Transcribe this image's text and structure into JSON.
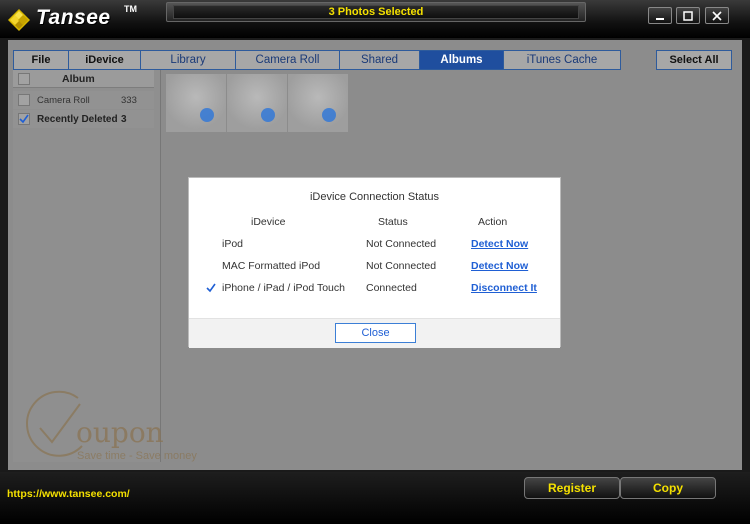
{
  "app": {
    "logo_text": "Tansee",
    "logo_tm": "TM",
    "title": "3 Photos Selected"
  },
  "tabs": [
    {
      "label": "File"
    },
    {
      "label": "iDevice"
    },
    {
      "label": "Library"
    },
    {
      "label": "Camera Roll"
    },
    {
      "label": "Shared"
    },
    {
      "label": "Albums"
    },
    {
      "label": "iTunes Cache"
    }
  ],
  "active_tab": "Albums",
  "select_all_label": "Select All",
  "album_list": {
    "header": "Album",
    "items": [
      {
        "name": "Camera Roll",
        "count": "333",
        "checked": false
      },
      {
        "name": "Recently Deleted",
        "count": "3",
        "checked": true
      }
    ]
  },
  "dialog": {
    "title": "iDevice Connection Status",
    "headers": {
      "device": "iDevice",
      "status": "Status",
      "action": "Action"
    },
    "rows": [
      {
        "device": "iPod",
        "status": "Not Connected",
        "action": "Detect Now",
        "selected": false
      },
      {
        "device": "MAC Formatted iPod",
        "status": "Not Connected",
        "action": "Detect Now",
        "selected": false
      },
      {
        "device": "iPhone / iPad / iPod Touch",
        "status": "Connected",
        "action": "Disconnect It",
        "selected": true
      }
    ],
    "close_label": "Close"
  },
  "watermark": {
    "text": "oupon",
    "sub": "Save time - Save money"
  },
  "footer": {
    "url": "https://www.tansee.com/",
    "register_label": "Register",
    "copy_label": "Copy"
  },
  "colors": {
    "accent": "#1f4e9e",
    "title_yellow": "#f4e000",
    "link": "#1f5fd4"
  }
}
